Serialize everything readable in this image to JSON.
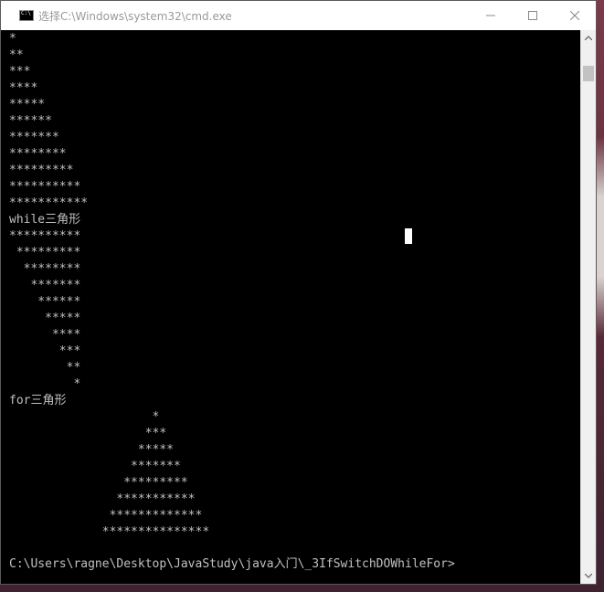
{
  "window": {
    "title": "选择C:\\Windows\\system32\\cmd.exe",
    "icon": "cmd-icon"
  },
  "controls": {
    "minimize": "minimize-icon",
    "maximize": "maximize-icon",
    "close": "close-icon"
  },
  "console": {
    "lines": [
      "*",
      "**",
      "***",
      "****",
      "*****",
      "******",
      "*******",
      "********",
      "*********",
      "**********",
      "***********",
      "while三角形",
      "**********",
      " *********",
      "  ********",
      "   *******",
      "    ******",
      "     *****",
      "      ****",
      "       ***",
      "        **",
      "         *",
      "for三角形",
      "                    *",
      "                   ***",
      "                  *****",
      "                 *******",
      "                *********",
      "               ***********",
      "              *************",
      "             ***************",
      "",
      "C:\\Users\\ragne\\Desktop\\JavaStudy\\java入门\\_3IfSwitchDOWhileFor>"
    ]
  }
}
